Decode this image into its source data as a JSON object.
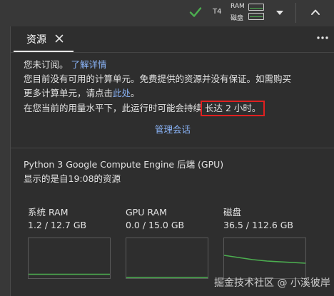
{
  "topbar": {
    "runtime_label": "T4",
    "ram_label": "RAM",
    "disk_label": "磁盘",
    "icons": [
      "check-icon",
      "chevron-down-icon",
      "chevron-up-icon"
    ],
    "status_color": "#4caf50"
  },
  "panel": {
    "tab_label": "资源",
    "close_glyph": "✕",
    "more_icon": "more-horiz-icon"
  },
  "info": {
    "line1_text": "您未订阅。",
    "line1_link": "了解详情",
    "line2": "您目前没有可用的计算单元。免费提供的资源并没有保证。如需购买",
    "line3_text": "更多计算单元，请点击",
    "line3_link": "此处",
    "line3_end": "。",
    "line4_text": "在您当前的用量水平下，此运行时可能会持续",
    "line4_highlight": "长达 2 小时",
    "line4_end": "。",
    "manage_link": "管理会话",
    "highlight_color": "#e02020",
    "link_color": "#8ab4f8"
  },
  "backend": {
    "title": "Python 3 Google Compute Engine 后端 (GPU)",
    "since": "显示的是自19:08的资源"
  },
  "metrics": [
    {
      "name": "系统 RAM",
      "value": "1.2 / 12.7 GB",
      "fraction": 0.094
    },
    {
      "name": "GPU RAM",
      "value": "0.0 / 15.0 GB",
      "fraction": 0.0
    },
    {
      "name": "磁盘",
      "value": "36.5 / 112.6 GB",
      "fraction": 0.324
    }
  ],
  "watermark": "掘金技术社区 @ 小溪彼岸"
}
